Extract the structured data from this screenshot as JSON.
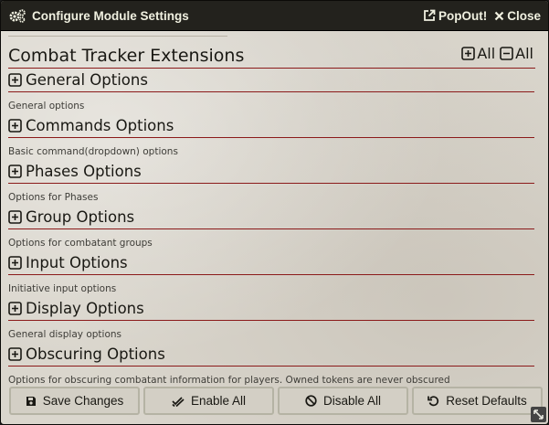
{
  "window": {
    "title": "Configure Module Settings",
    "popout_label": "PopOut!",
    "close_label": "Close"
  },
  "main": {
    "title": "Combat Tracker Extensions",
    "expand_all_label": "All",
    "collapse_all_label": "All"
  },
  "sections": [
    {
      "title": "General Options",
      "description": "General options"
    },
    {
      "title": "Commands Options",
      "description": "Basic command(dropdown) options"
    },
    {
      "title": "Phases Options",
      "description": "Options for Phases"
    },
    {
      "title": "Group Options",
      "description": "Options for combatant groups"
    },
    {
      "title": "Input Options",
      "description": "Initiative input options"
    },
    {
      "title": "Display Options",
      "description": "General display options"
    },
    {
      "title": "Obscuring Options",
      "description": "Options for obscuring combatant information for players. Owned tokens are never obscured"
    }
  ],
  "footer": {
    "save_label": "Save Changes",
    "enable_label": "Enable All",
    "disable_label": "Disable All",
    "reset_label": "Reset Defaults"
  },
  "icons": {
    "header": "cogs-icon",
    "popout": "external-link-icon",
    "close": "close-icon",
    "expand": "plus-square-icon",
    "collapse": "minus-square-icon",
    "save": "save-icon",
    "enable": "check-double-icon",
    "disable": "ban-icon",
    "reset": "undo-icon",
    "resize": "resize-handle-icon"
  },
  "colors": {
    "header_bg": "#23221d",
    "divider": "#8b1a1a",
    "button_bg": "#d3cfc5"
  }
}
